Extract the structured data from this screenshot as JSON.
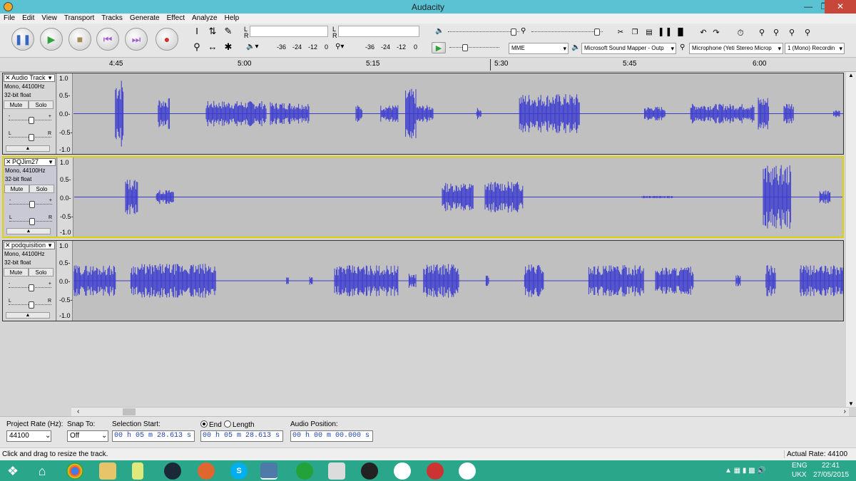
{
  "window": {
    "title": "Audacity",
    "minimize_icon": "minimize-icon",
    "restore_icon": "restore-icon",
    "close_icon": "close-icon"
  },
  "menu": [
    "File",
    "Edit",
    "View",
    "Transport",
    "Tracks",
    "Generate",
    "Effect",
    "Analyze",
    "Help"
  ],
  "toolbar": {
    "meter_scale_playback": [
      "-36",
      "-24",
      "-12",
      "0"
    ],
    "meter_scale_record": [
      "-36",
      "-24",
      "-12",
      "0"
    ],
    "meter_lr": [
      "L",
      "R"
    ],
    "host": "MME",
    "output_device": "Microsoft Sound Mapper - Outp",
    "input_device": "Microphone (Yeti Stereo Microp",
    "channels": "1 (Mono) Recordin"
  },
  "timeline": {
    "ticks": [
      "4:45",
      "5:00",
      "5:15",
      "5:30",
      "5:45",
      "6:00"
    ]
  },
  "tracks": [
    {
      "name": "Audio Track",
      "format": "Mono, 44100Hz",
      "bits": "32-bit float",
      "mute": "Mute",
      "solo": "Solo",
      "scale": [
        "1.0",
        "0.5-",
        "0.0-",
        "-0.5-",
        "-1.0"
      ]
    },
    {
      "name": "PQJim27",
      "format": "Mono, 44100Hz",
      "bits": "32-bit float",
      "mute": "Mute",
      "solo": "Solo",
      "scale": [
        "1.0",
        "0.5-",
        "0.0-",
        "-0.5-",
        "-1.0"
      ]
    },
    {
      "name": "podquisition",
      "format": "Mono, 44100Hz",
      "bits": "32-bit float",
      "mute": "Mute",
      "solo": "Solo",
      "scale": [
        "1.0",
        "0.5-",
        "0.0-",
        "-0.5-",
        "-1.0"
      ]
    }
  ],
  "selection_bar": {
    "project_rate_label": "Project Rate (Hz):",
    "project_rate": "44100",
    "snap_to_label": "Snap To:",
    "snap_to": "Off",
    "selection_start_label": "Selection Start:",
    "selection_start": "00 h 05 m 28.613 s",
    "end_label": "End",
    "length_label": "Length",
    "selection_end": "00 h 05 m 28.613 s",
    "audio_position_label": "Audio Position:",
    "audio_position": "00 h 00 m 00.000 s"
  },
  "status": {
    "message": "Click and drag to resize the track.",
    "actual_rate": "Actual Rate: 44100"
  },
  "taskbar": {
    "lang": "ENG",
    "locale": "UKX",
    "time": "22:41",
    "date": "27/05/2015"
  }
}
